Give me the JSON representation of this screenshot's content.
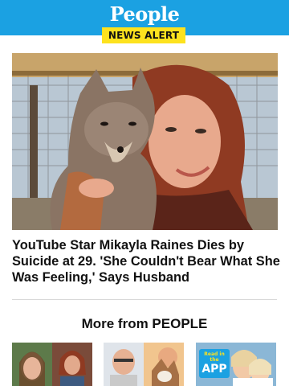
{
  "header": {
    "logo_text": "People",
    "badge_text": "NEWS ALERT",
    "background_color": "#1ba1e2",
    "badge_color": "#fde21e"
  },
  "article": {
    "headline": "YouTube Star Mikayla Raines Dies by Suicide at 29. 'She Couldn't Bear What She Was Feeling,' Says Husband"
  },
  "more": {
    "title": "More from PEOPLE",
    "thumbnails": [
      {
        "app_badge_small": "",
        "app_badge_big": ""
      },
      {
        "app_badge_small": "",
        "app_badge_big": ""
      },
      {
        "app_badge_small": "Read in the",
        "app_badge_big": "APP"
      }
    ]
  }
}
